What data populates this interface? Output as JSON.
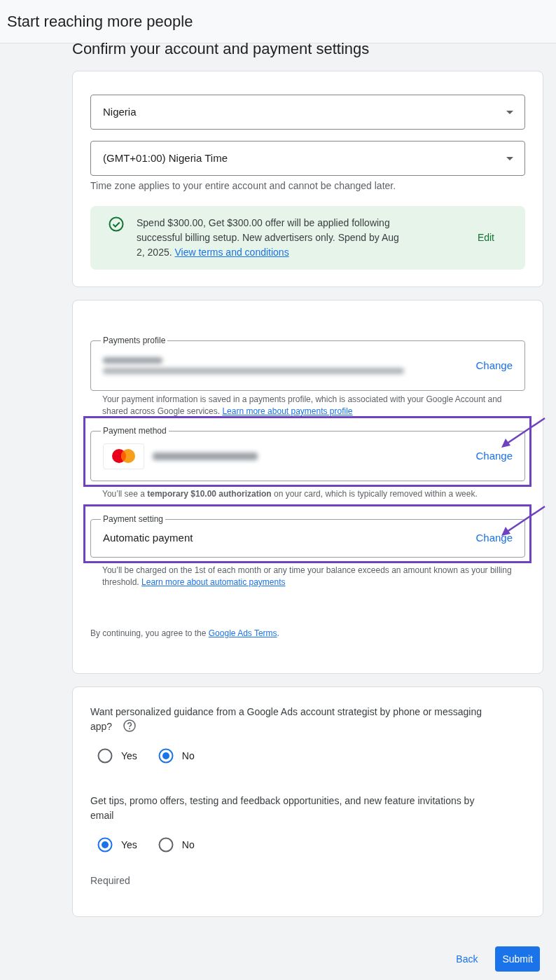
{
  "header": {
    "title": "Start reaching more people"
  },
  "heading": "Confirm your account and payment settings",
  "account_card": {
    "selects": [
      {
        "value": "Nigeria"
      },
      {
        "value": "(GMT+01:00) Nigeria Time"
      }
    ],
    "hint": "Time zone applies to your entire account and cannot be changed later.",
    "offer": {
      "text": "Spend $300.00, Get $300.00 offer will be applied following successful billing setup. New advertisers only. Spend by Aug 2, 2025.",
      "link": "View terms and conditions",
      "action": "Edit"
    }
  },
  "payment_card": {
    "fields": [
      {
        "kind": "profile",
        "label": "Payments profile",
        "redacted": true,
        "action": "Change",
        "highlighted": false,
        "note": "Your payment information is saved in a payments profile, which is associated with your Google Account and shared across Google services.",
        "note_link": "Learn more about payments profile"
      },
      {
        "kind": "card",
        "label": "Payment method",
        "redacted": true,
        "action": "Change",
        "highlighted": true,
        "note": "You’ll see a **temporary $10.00 authorization** on your card, which is typically removed within a week."
      },
      {
        "kind": "setting",
        "label": "Payment setting",
        "value": "Automatic payment",
        "action": "Change",
        "highlighted": true,
        "note": "You’ll be charged on the 1st of each month or any time your balance exceeds an amount known as your billing threshold.",
        "note_link": "Learn more about automatic payments"
      }
    ],
    "terms": {
      "before": "By continuing, you agree to the",
      "link": "Google Ads Terms",
      "after": "."
    }
  },
  "preferences": {
    "questions": [
      {
        "text": "Want personalized guidance from a Google Ads account strategist by phone or messaging app?",
        "help": true,
        "options": [
          {
            "label": "Yes",
            "selected": false
          },
          {
            "label": "No",
            "selected": true
          }
        ]
      },
      {
        "text": "Get tips, promo offers, testing and feedback opportunities, and new feature invitations by email",
        "help": false,
        "options": [
          {
            "label": "Yes",
            "selected": true
          },
          {
            "label": "No",
            "selected": false
          }
        ]
      }
    ],
    "required_note": "Required"
  },
  "buttons": [
    {
      "label": "Back",
      "kind": "text"
    },
    {
      "label": "Submit",
      "kind": "primary"
    }
  ]
}
